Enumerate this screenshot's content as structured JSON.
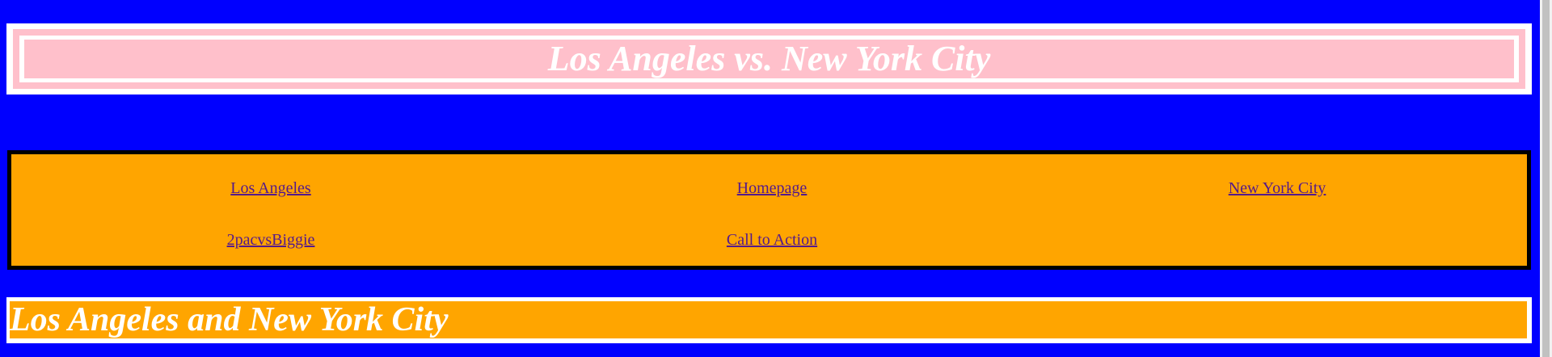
{
  "header": {
    "title": "Los Angeles vs. New York City"
  },
  "nav": {
    "links": [
      {
        "label": "Los Angeles"
      },
      {
        "label": "Homepage"
      },
      {
        "label": "New York City"
      },
      {
        "label": "2pacvsBiggie"
      },
      {
        "label": "Call to Action"
      }
    ]
  },
  "section": {
    "heading": "Los Angeles and New York City"
  },
  "colors": {
    "background": "#0000ff",
    "title_bg": "#ffc0cb",
    "nav_bg": "#ffa500",
    "link": "#551a8b"
  }
}
